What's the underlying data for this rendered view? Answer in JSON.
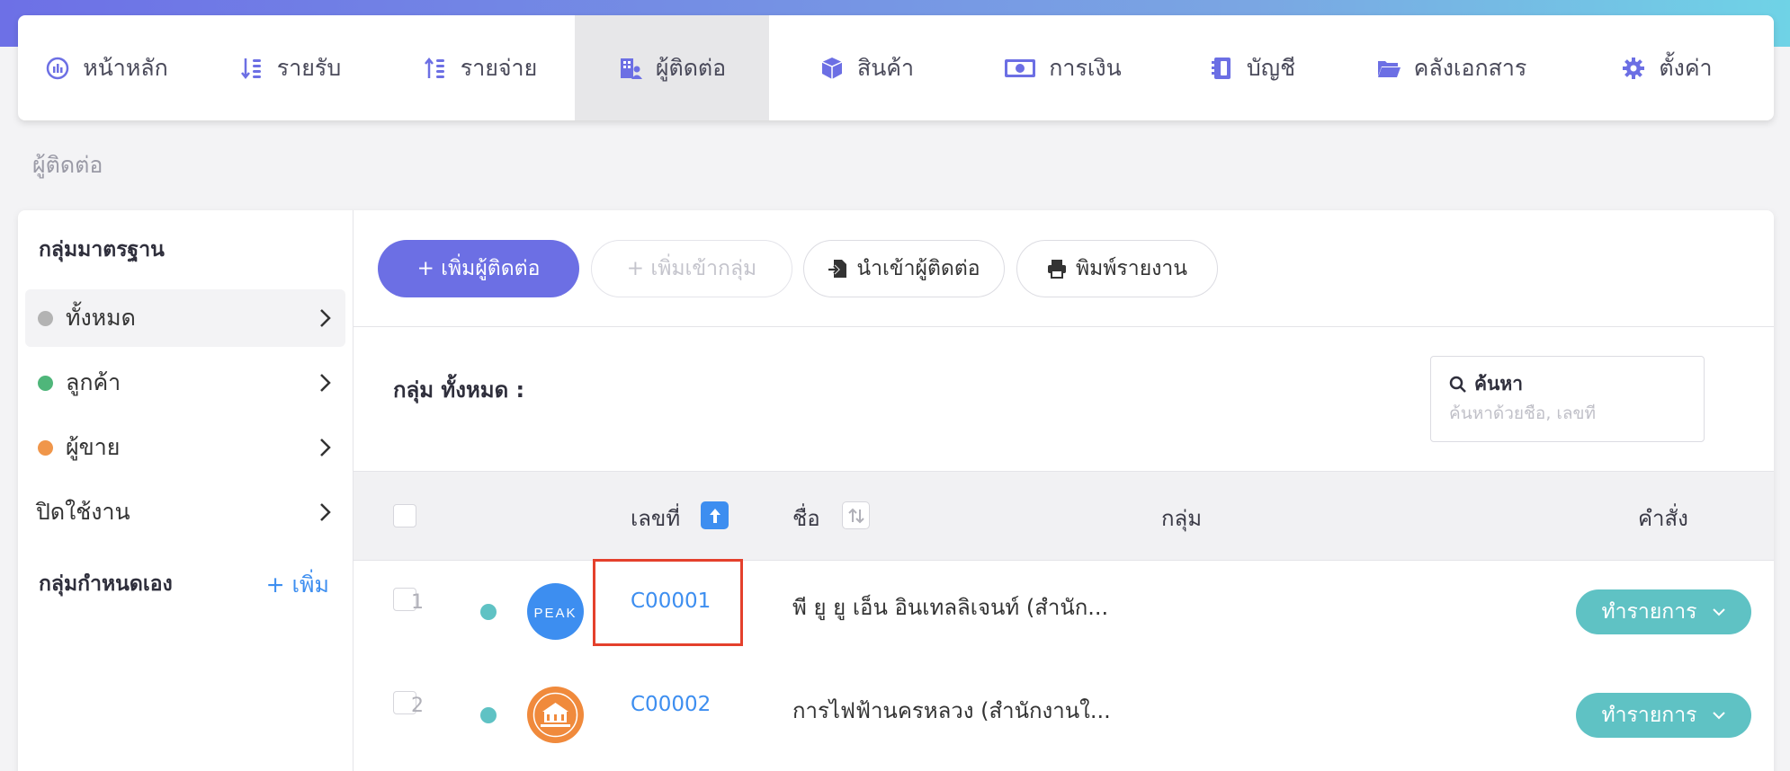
{
  "nav": {
    "items": [
      {
        "label": "หน้าหลัก",
        "icon": "dashboard-gauge-icon"
      },
      {
        "label": "รายรับ",
        "icon": "income-sort-icon"
      },
      {
        "label": "รายจ่าย",
        "icon": "expense-sort-icon"
      },
      {
        "label": "ผู้ติดต่อ",
        "icon": "contacts-building-icon",
        "active": true
      },
      {
        "label": "สินค้า",
        "icon": "product-box-icon"
      },
      {
        "label": "การเงิน",
        "icon": "money-bill-icon"
      },
      {
        "label": "บัญชี",
        "icon": "account-book-icon"
      },
      {
        "label": "คลังเอกสาร",
        "icon": "folder-open-icon"
      },
      {
        "label": "ตั้งค่า",
        "icon": "gear-icon"
      }
    ]
  },
  "page": {
    "title": "ผู้ติดต่อ"
  },
  "sidebar": {
    "standard_heading": "กลุ่มมาตรฐาน",
    "items": [
      {
        "label": "ทั้งหมด",
        "dot_color": "#b3b3b3",
        "active": true
      },
      {
        "label": "ลูกค้า",
        "dot_color": "#4fb67a"
      },
      {
        "label": "ผู้ขาย",
        "dot_color": "#f0964a"
      },
      {
        "label": "ปิดใช้งาน"
      }
    ],
    "custom_heading": "กลุ่มกำหนดเอง",
    "add_label": "+ เพิ่ม"
  },
  "toolbar": {
    "add_contact": "+ เพิ่มผู้ติดต่อ",
    "add_to_group": "+ เพิ่มเข้ากลุ่ม",
    "import_contacts": "นำเข้าผู้ติดต่อ",
    "print_report": "พิมพ์รายงาน"
  },
  "group_label": "กลุ่ม ทั้งหมด :",
  "search": {
    "title": "ค้นหา",
    "placeholder": "ค้นหาด้วยชื่อ, เลขที่"
  },
  "table": {
    "headers": {
      "number": "เลขที่",
      "name": "ชื่อ",
      "group": "กลุ่ม",
      "command": "คำสั่ง"
    },
    "rows": [
      {
        "index": "1",
        "code": "C00001",
        "name": "พี ยู ยู เอ็น อินเทลลิเจนท์ (สำนัก...",
        "action": "ทำรายการ",
        "avatar": "PEAK"
      },
      {
        "index": "2",
        "code": "C00002",
        "name": "การไฟฟ้านครหลวง (สำนักงานใ...",
        "action": "ทำรายการ",
        "avatar": "seal"
      }
    ]
  },
  "colors": {
    "primary": "#6c6fe4",
    "link": "#3d8ef0",
    "teal": "#5fc2c4",
    "highlight": "#e4402c"
  }
}
